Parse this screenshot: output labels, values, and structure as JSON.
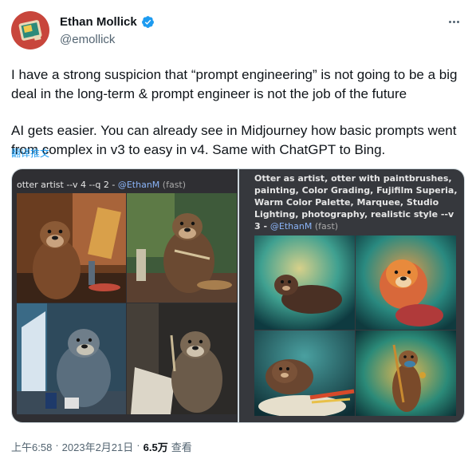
{
  "author": {
    "display_name": "Ethan Mollick",
    "handle": "@emollick",
    "verified": true,
    "avatar_icon": "pixel-computer-avatar"
  },
  "tweet": {
    "paragraph1": "I have a strong suspicion that “prompt engineering” is not going to be a big deal in the long-term & prompt engineer is not the job of the future",
    "paragraph2": "AI gets easier. You can already see in Midjourney how basic prompts went from complex in v3 to easy in v4. Same with ChatGPT to Bing.",
    "translate_label": "翻译推文"
  },
  "media": {
    "left": {
      "prompt_text": "otter artist --v 4 --q 2 - ",
      "mention": "@EthanM",
      "suffix": " (fast)"
    },
    "right": {
      "prompt_text": "Otter as artist, otter with paintbrushes, painting, Color Grading, Fujifilm Superia, Warm Color Palette, Marquee, Studio Lighting, photography, realistic style --v 3 - ",
      "mention": "@EthanM",
      "suffix": " (fast)"
    }
  },
  "footer": {
    "time": "上午6:58",
    "date": "2023年2月21日",
    "separator": "·",
    "views_count": "6.5万",
    "views_label": "查看"
  },
  "colors": {
    "link": "#1d9bf0",
    "secondary_text": "#536471",
    "verified_badge": "#1d9bf0"
  }
}
